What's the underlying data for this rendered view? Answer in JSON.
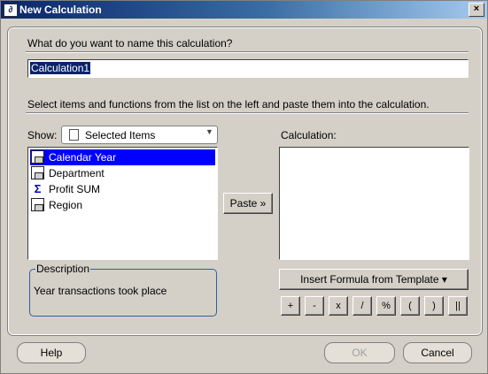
{
  "window": {
    "title": "New Calculation",
    "close_label": "×"
  },
  "name_section": {
    "prompt": "What do you want to name this calculation?",
    "value": "Calculation1"
  },
  "instructions": "Select items and functions from the list on the left and paste them into the calculation.",
  "show": {
    "label": "Show:",
    "selected": "Selected Items"
  },
  "items": [
    {
      "label": "Calendar Year",
      "icon": "dimension-item-icon",
      "selected": true
    },
    {
      "label": "Department",
      "icon": "dimension-item-icon",
      "selected": false
    },
    {
      "label": "Profit SUM",
      "icon": "sum-measure-icon",
      "selected": false
    },
    {
      "label": "Region",
      "icon": "dimension-item-icon",
      "selected": false
    }
  ],
  "paste_button": {
    "label": "Paste",
    "glyph": "»"
  },
  "calculation": {
    "label": "Calculation:",
    "value": ""
  },
  "description": {
    "label": "Description",
    "text": "Year transactions took place"
  },
  "template_button": {
    "label": "Insert Formula from Template",
    "arrow": "▾"
  },
  "operators": [
    "+",
    "-",
    "x",
    "/",
    "%",
    "(",
    ")",
    "||"
  ],
  "footer": {
    "help": "Help",
    "ok": "OK",
    "cancel": "Cancel"
  }
}
